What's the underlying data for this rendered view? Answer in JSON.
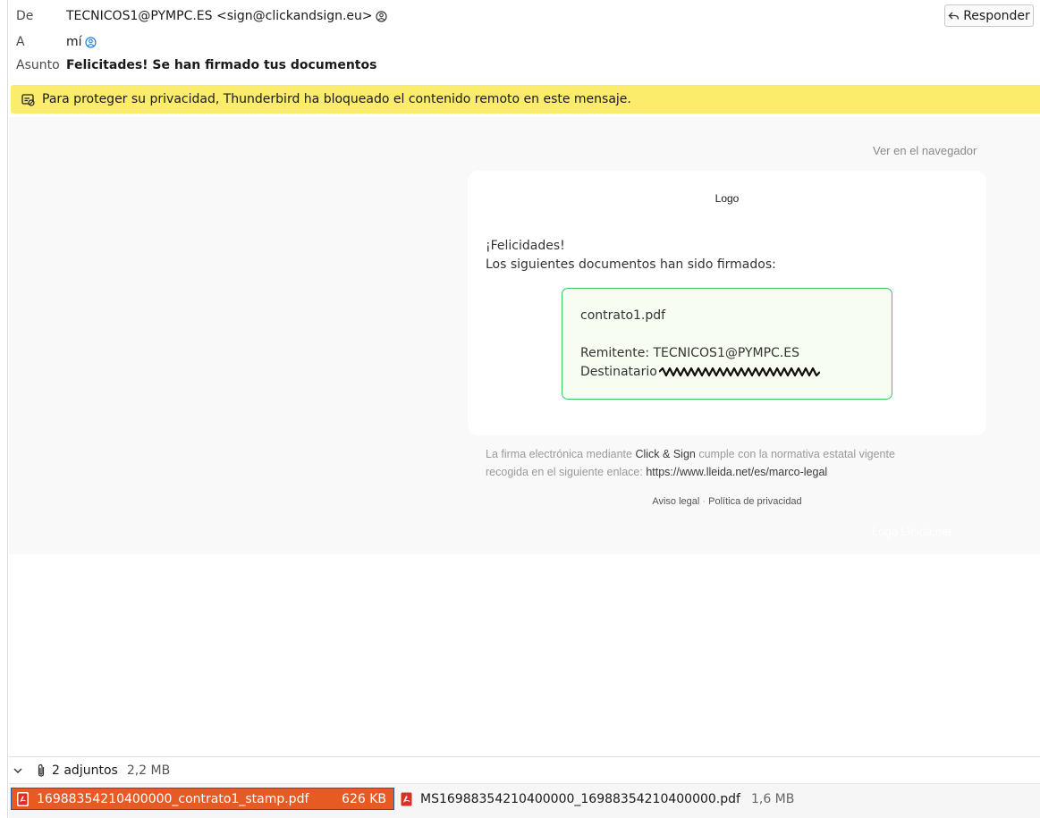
{
  "header": {
    "from_label": "De",
    "from_value": "TECNICOS1@PYMPC.ES <sign@clickandsign.eu>",
    "to_label": "A",
    "to_value": "mí",
    "subject_label": "Asunto",
    "subject_value": "Felicitades! Se han firmado tus documentos",
    "reply_label": "Responder"
  },
  "notice": {
    "text": "Para proteger su privacidad, Thunderbird ha bloqueado el contenido remoto en este mensaje."
  },
  "message": {
    "view_in_browser": "Ver en el navegador",
    "logo_alt": "Logo",
    "greeting": "¡Felicidades!",
    "intro": "Los siguientes documentos han sido firmados:",
    "document_name": "contrato1.pdf",
    "sender_line": "Remitente: TECNICOS1@PYMPC.ES",
    "recipient_label": "Destinatario",
    "legal_1": "La firma electrónica mediante",
    "legal_brand": "Click & Sign",
    "legal_2": "cumple con la normativa estatal vigente",
    "legal_3": "recogida en el siguiente enlace:",
    "legal_link": "https://www.lleida.net/es/marco-legal",
    "footer_link_1": "Aviso legal",
    "footer_sep": "·",
    "footer_link_2": "Política de privacidad",
    "footer_logo": "Logo Lleida.net"
  },
  "attachments": {
    "summary": "2 adjuntos",
    "total_size": "2,2 MB",
    "items": [
      {
        "name": "16988354210400000_contrato1_stamp.pdf",
        "size": "626 KB",
        "selected": true
      },
      {
        "name": "MS16988354210400000_16988354210400000.pdf",
        "size": "1,6 MB",
        "selected": false
      }
    ]
  },
  "colors": {
    "notice_bg": "#fbed6b",
    "selected_attachment": "#e85a24",
    "doc_box_border": "#37c86a"
  }
}
